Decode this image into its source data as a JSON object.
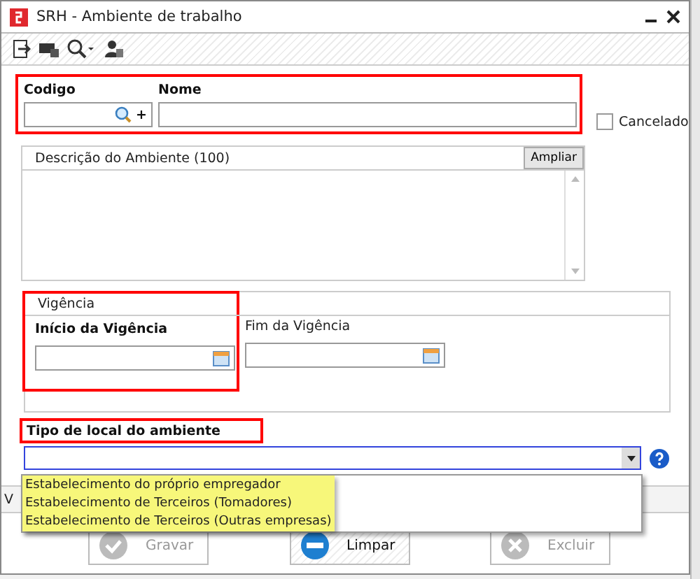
{
  "window": {
    "title": "SRH - Ambiente de trabalho"
  },
  "codigo": {
    "label": "Codigo",
    "plus": "+"
  },
  "nome": {
    "label": "Nome"
  },
  "cancelado": {
    "label": "Cancelado",
    "checked": false
  },
  "descricao": {
    "label": "Descrição do Ambiente (100)",
    "button": "Ampliar"
  },
  "vigencia": {
    "title": "Vigência",
    "inicio": "Início da Vigência",
    "fim": "Fim da Vigência"
  },
  "tipo": {
    "label": "Tipo de local do ambiente",
    "expanded": true,
    "options": [
      {
        "label": "Estabelecimento do próprio empregador"
      },
      {
        "label": "Estabelecimento de Terceiros (Tomadores)"
      },
      {
        "label": "Estabelecimento de Terceiros (Outras empresas)"
      }
    ]
  },
  "status_bar": "V",
  "buttons": [
    {
      "label": "Gravar",
      "kind": "save",
      "disabled": true
    },
    {
      "label": "Limpar",
      "kind": "clear",
      "disabled": false
    },
    {
      "label": "Excluir",
      "kind": "delete",
      "disabled": true
    }
  ]
}
